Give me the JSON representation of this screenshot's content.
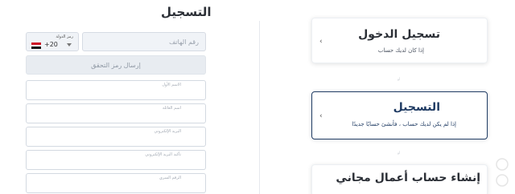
{
  "form": {
    "title": "التسجيل",
    "country": {
      "label": "رمز الدولة",
      "code": "+20",
      "flag": "egypt-flag-icon"
    },
    "phone_placeholder": "رقم الهاتف",
    "verify_button": "إرسال رمز التحقق",
    "fields": [
      {
        "label": "الاسم الأول"
      },
      {
        "label": "اسم العائلة"
      },
      {
        "label": "البريد الإلكتروني"
      },
      {
        "label": "تأكيد البريد الإلكتروني"
      },
      {
        "label": "الرقم السري"
      }
    ]
  },
  "options": {
    "login": {
      "title": "تسجيل الدخول",
      "subtitle": "إذا كان لديك حساب"
    },
    "or_1": "أو",
    "register": {
      "title": "التسجيل",
      "subtitle": "إذا لم يكن لديك حساب ، فأنشئ حسابًا جديدًا"
    },
    "or_2": "أو",
    "business": {
      "title": "إنشاء حساب أعمال مجاني"
    }
  },
  "colors": {
    "accent": "#1f3b63",
    "input_border": "#d6dbe3",
    "disabled_bg": "#e8ecf1"
  }
}
